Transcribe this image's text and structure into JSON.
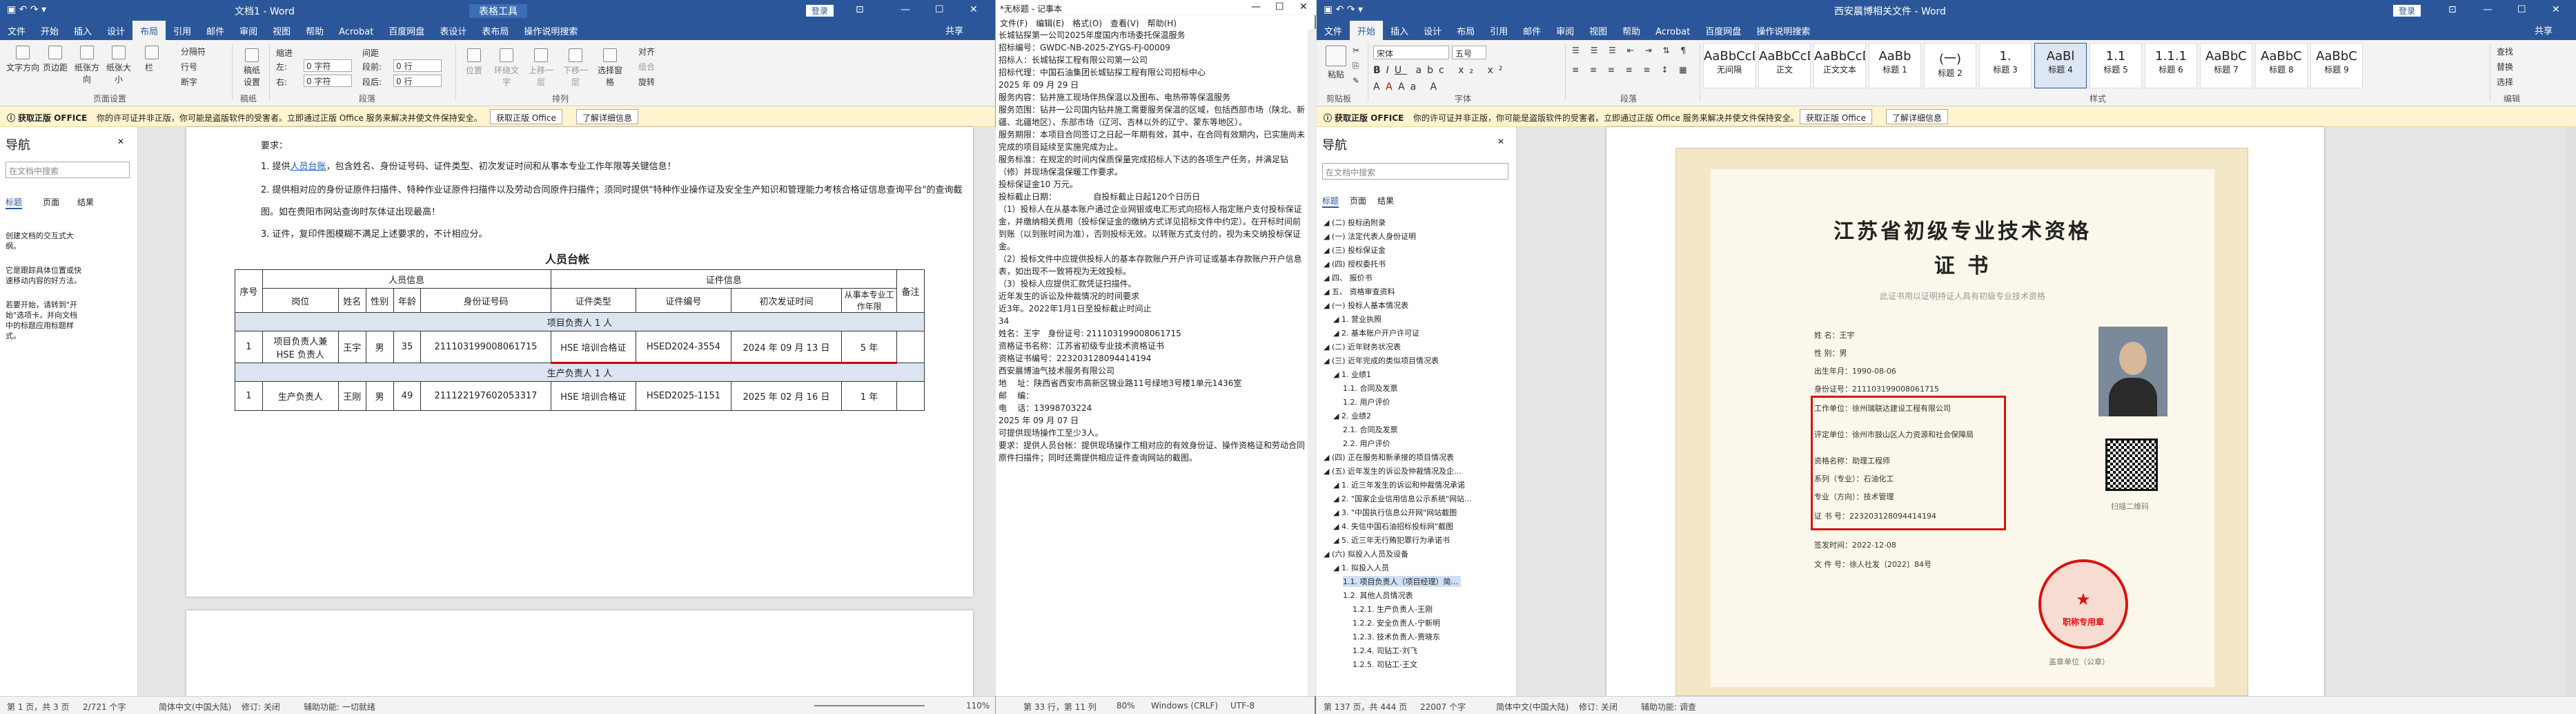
{
  "w1": {
    "title": "文档1 - Word",
    "context_tab": "表格工具",
    "login": "登录",
    "tabs": [
      "文件",
      "开始",
      "插入",
      "设计",
      "布局",
      "引用",
      "邮件",
      "审阅",
      "视图",
      "帮助",
      "Acrobat",
      "百度网盘",
      "表设计",
      "表布局",
      "操作说明搜索"
    ],
    "share": "共享",
    "ribbon": {
      "textdir": "文字方向",
      "margins": "页边距",
      "orient": "纸张方向",
      "size": "纸张大小",
      "columns": "栏",
      "breaks": "分隔符",
      "linenum": "行号",
      "hyphen": "断字",
      "draft": "稿纸设置",
      "indent": "缩进",
      "spacing": "间距",
      "left": "左:",
      "right": "右:",
      "before": "段前:",
      "after": "段后:",
      "zero_char": "0 字符",
      "zero_line": "0 行",
      "position": "位置",
      "wrap": "环绕文字",
      "forward": "上移一层",
      "backward": "下移一层",
      "pane": "选择窗格",
      "align": "对齐",
      "group": "组合",
      "rotate": "旋转",
      "g1": "页面设置",
      "g2": "稿纸",
      "g3": "段落",
      "g4": "排列"
    },
    "msg": {
      "label": "获取正版 OFFICE",
      "text": "你的许可证并非正版，你可能是盗版软件的受害者。立即通过正版 Office 服务来解决并使文件保持安全。",
      "b1": "获取正版 Office",
      "b2": "了解详细信息"
    },
    "nav": {
      "title": "导航",
      "search": "在文档中搜索",
      "t1": "标题",
      "t2": "页面",
      "t3": "结果",
      "p1": "创建文档的交互式大纲。",
      "p2": "它是跟踪具体位置或快速移动内容的好方法。",
      "p3": "若要开始，请转到\"开始\"选项卡，并向文档中的标题应用标题样式。"
    },
    "doc": {
      "req": "要求：",
      "l1a": "1. 提供",
      "l1b": "人员台账",
      "l1c": "，包含姓名、身份证号码、证件类型、初次发证时间和从事本专业工作年限等关键信息！",
      "l2": "2. 提供相对应的身份证原件扫描件、特种作业证原件扫描件以及劳动合同原件扫描件；须同时提供\"特种作业操作证及安全生产知识和管理能力考核合格证信息查询平台\"的查询截",
      "l2b": "图。如在贵阳市网站查询时灰体证出现最高！",
      "l3": "3. 证件，复印件图模糊不满足上述要求的，不计相应分。",
      "table_title": "人员台帐",
      "h": {
        "seq": "序号",
        "person": "人员信息",
        "cert": "证件信息",
        "note": "备注",
        "pos": "岗位",
        "name": "姓名",
        "sex": "性别",
        "age": "年龄",
        "id": "身份证号码",
        "ctype": "证件类型",
        "cno": "证件编号",
        "first": "初次发证时间",
        "years": "从事本专业工作年限"
      },
      "sec1": "项目负责人 1 人",
      "r1": {
        "seq": "1",
        "pos": "项目负责人兼 HSE 负责人",
        "name": "王宇",
        "sex": "男",
        "age": "35",
        "id": "211103199008061715",
        "ctype": "HSE 培训合格证",
        "cno": "HSED2024-3554",
        "first": "2024 年 09 月 13 日",
        "years": "5 年"
      },
      "sec2": "生产负责人 1 人",
      "r2": {
        "seq": "1",
        "pos": "生产负责人",
        "name": "王刚",
        "sex": "男",
        "age": "49",
        "id": "211122197602053317",
        "ctype": "HSE 培训合格证",
        "cno": "HSED2025-1151",
        "first": "2025 年 02 月 16 日",
        "years": "1 年"
      }
    },
    "status": {
      "page": "第 1 页，共 3 页",
      "words": "2/721 个字",
      "lang": "简体中文(中国大陆)",
      "track": "修订: 关闭",
      "access": "辅助功能: 一切就绪",
      "zoom": "110%"
    }
  },
  "np": {
    "title": "*无标题 - 记事本",
    "menu": [
      "文件(F)",
      "编辑(E)",
      "格式(O)",
      "查看(V)",
      "帮助(H)"
    ],
    "lines": [
      "长城钻探第一公司2025年度国内市场委托保温服务",
      "",
      "招标编号：GWDC-NB-2025-ZYGS-FJ-00009",
      "",
      "招标人：长城钻探工程有限公司第一公司",
      "",
      "招标代理：中国石油集团长城钻探工程有限公司招标中心",
      "2025 年 09 月 29 日",
      "",
      "服务内容：钻井施工现场伴热保温以及图布、电热带等保温服务",
      "",
      "服务范围：钻井一公司国内钻井施工需要服务保温的区域，包括西部市场（陕北、新疆、北疆地区）、东部市场（辽河、吉林以外的辽宁、蒙东等地区）。",
      "",
      "服务期限：本项目合同签订之日起一年期有效，其中，在合同有效期内，已实施尚未完成的项目延续至实施完成为止。",
      "",
      "服务标准：在规定的时间内保质保量完成招标人下达的各项生产任务，并满足钻（修）井现场保温保暖工作要求。",
      "",
      "投标保证金10 万元。",
      "",
      "投标截止日期：              自投标截止日起120个日历日",
      "",
      "（1）投标人在从基本账户通过企业网银或电汇形式向招标人指定账户支付投标保证金，并缴纳相关费用（投标保证金的缴纳方式详见招标文件中约定）。在开标时间前到账（以到账时间为准），否则投标无效。以转账方式支付的，视为未交纳投标保证金。",
      "（2）投标文件中应提供投标人的基本存款账户开户许可证或基本存款账户开户信息表，如出现不一致将视为无效投标。",
      "（3）投标人应提供汇款凭证扫描件。",
      "",
      "近年发生的诉讼及仲裁情况的时间要求",
      "近3年。2022年1月1日至投标截止时间止",
      "",
      "34",
      "",
      "姓名：王宇   身份证号: 211103199008061715",
      "资格证书名称：江苏省初级专业技术资格证书",
      "资格证书编号：223203128094414194",
      "",
      "西安晨博油气技术服务有限公司",
      "地    址：陕西省西安市高新区锦业路11号绿地3号楼1单元1436室",
      "邮    编：",
      "电    话：13998703224",
      "2025 年 09 月 07 日",
      "",
      "可提供现场操作工至少3人。",
      "要求：提供人员台帐：提供现场操作工相对应的有效身份证、操作资格证和劳动合同原件扫描件；同时还需提供相应证件查询网站的截图。"
    ],
    "status": {
      "pos": "第 33 行，第 11 列",
      "zoom": "80%",
      "eol": "Windows (CRLF)",
      "enc": "UTF-8"
    }
  },
  "w2": {
    "title": "西安晨博相关文件 - Word",
    "login": "登录",
    "tabs": [
      "文件",
      "开始",
      "插入",
      "设计",
      "布局",
      "引用",
      "邮件",
      "审阅",
      "视图",
      "帮助",
      "Acrobat",
      "百度网盘",
      "操作说明搜索"
    ],
    "share": "共享",
    "ribbon": {
      "paste": "粘贴",
      "font": "宋体",
      "size": "五号",
      "find": "查找",
      "replace": "替换",
      "select": "选择",
      "g1": "剪贴板",
      "g2": "字体",
      "g3": "段落",
      "g4": "样式",
      "g5": "编辑"
    },
    "styles": [
      {
        "p": "AaBbCcDd",
        "n": "无间隔"
      },
      {
        "p": "AaBbCcDd",
        "n": "正文"
      },
      {
        "p": "AaBbCcDd",
        "n": "正文文本"
      },
      {
        "p": "AaBb",
        "n": "标题 1"
      },
      {
        "p": "(一)",
        "n": "标题 2"
      },
      {
        "p": "1.",
        "n": "标题 3"
      },
      {
        "p": "AaBl",
        "n": "标题 4"
      },
      {
        "p": "1.1",
        "n": "标题 5"
      },
      {
        "p": "1.1.1",
        "n": "标题 6"
      },
      {
        "p": "AaBbC",
        "n": "标题 7"
      },
      {
        "p": "AaBbC",
        "n": "标题 8"
      },
      {
        "p": "AaBbC",
        "n": "标题 9"
      }
    ],
    "msg": {
      "label": "获取正版 OFFICE",
      "text": "你的许可证并非正版，你可能是盗版软件的受害者。立即通过正版 Office 服务来解决并使文件保持安全。",
      "b1": "获取正版 Office",
      "b2": "了解详细信息"
    },
    "nav": {
      "title": "导航",
      "search": "在文档中搜索",
      "t1": "标题",
      "t2": "页面",
      "t3": "结果",
      "items": [
        "(二) 投标函附录",
        "(一) 法定代表人身份证明",
        "(三) 投标保证金",
        "(四) 授权委托书",
        "四、 报价书",
        "五、 资格审查资料",
        "(一) 投标人基本情况表",
        "1. 营业执照",
        "2. 基本账户开户许可证",
        "(二) 近年财务状况表",
        "(三) 近年完成的类似项目情况表",
        "1. 业绩1",
        "1.1. 合同及发票",
        "1.2. 用户评价",
        "2. 业绩2",
        "2.1. 合同及发票",
        "2.2. 用户评价",
        "(四) 正在服务和新承接的项目情况表",
        "(五) 近年发生的诉讼及仲裁情况及企...",
        "1. 近三年发生的诉讼和仲裁情况承诺",
        "2. \"国家企业信用信息公示系统\"网站...",
        "3. \"中国执行信息公开网\"网站截图",
        "4. 失信中国石油招标投标网\"截图",
        "5. 近三年无行贿犯罪行为承诺书",
        "(六) 拟投入人员及设备",
        "1. 拟投入人员",
        "1.1. 项目负责人（项目经理）简...",
        "1.2. 其他人员情况表",
        "1.2.1. 生产负责人-王刚",
        "1.2.2. 安全负责人-宁新明",
        "1.2.3. 技术负责人-贾晓东",
        "1.2.4. 司钻工-刘飞",
        "1.2.5. 司钻工-王文"
      ]
    },
    "cert": {
      "title1": "江苏省初级专业技术资格",
      "title2": "证  书",
      "sub": "此证书用以证明持证人具有初级专业技术资格",
      "name_l": "姓    名：",
      "name": "王宇",
      "sex_l": "性    别：",
      "sex": "男",
      "dob_l": "出生年月：",
      "dob": "1990-08-06",
      "id_l": "身份证号：",
      "id": "211103199008061715",
      "unit_l": "工作单位：",
      "unit": "徐州瑞联达建设工程有限公司",
      "org_l": "评定单位：",
      "org": "徐州市鼓山区人力资源和社会保障局",
      "title_l": "资格名称：",
      "title_v": "助理工程师",
      "series_l": "系列（专业）：",
      "series": "石油化工",
      "major_l": "专业（方向）：",
      "major": "技术管理",
      "no_l": "证    书    号：",
      "no": "223203128094414194",
      "issue_l": "签发时间：",
      "issue": "2022-12-08",
      "doc_l": "文    件    号：",
      "doc": "徐人社发〔2022〕84号",
      "qr_cap": "扫描二维码",
      "seal": "职称专用章",
      "seal_cap": "盖章单位（公章）"
    },
    "status": {
      "page": "第 137 页，共 444 页",
      "words": "22007 个字",
      "lang": "简体中文(中国大陆)",
      "track": "修订: 关闭",
      "access": "辅助功能: 调查"
    }
  }
}
